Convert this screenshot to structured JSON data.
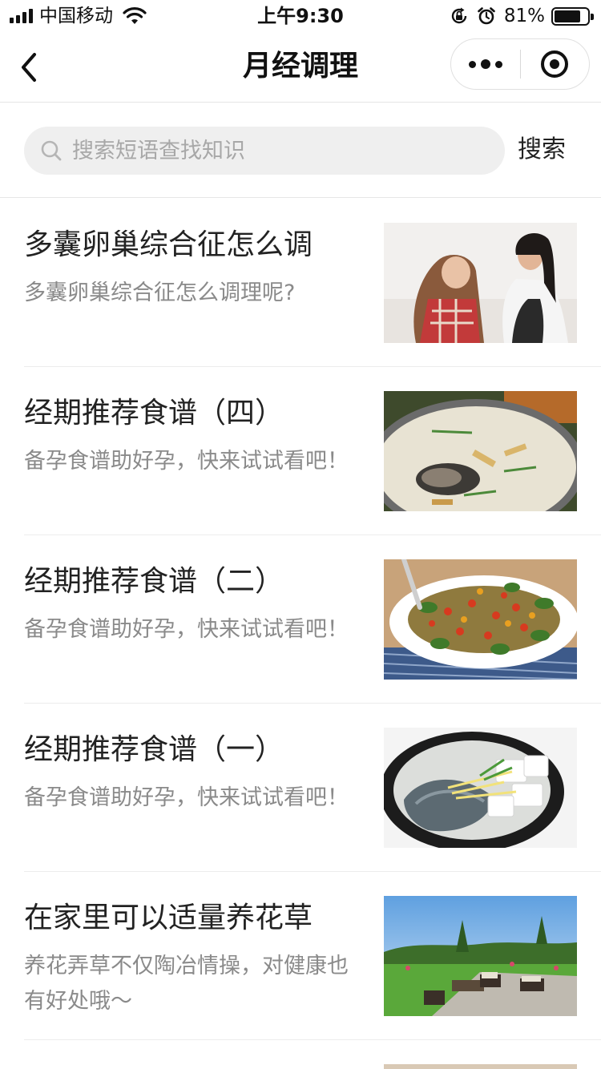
{
  "status_bar": {
    "carrier": "中国移动",
    "time": "上午9:30",
    "battery_percent": "81%",
    "battery_level": 0.81
  },
  "nav": {
    "title": "月经调理"
  },
  "search": {
    "placeholder": "搜索短语查找知识",
    "button_label": "搜索"
  },
  "articles": [
    {
      "title": "多囊卵巢综合征怎么调",
      "desc": "多囊卵巢综合征怎么调理呢?",
      "image": "two-women-talking-photo"
    },
    {
      "title": "经期推荐食谱（四）",
      "desc": "备孕食谱助好孕，快来试试看吧！",
      "image": "fish-soup-photo"
    },
    {
      "title": "经期推荐食谱（二）",
      "desc": "备孕食谱助好孕，快来试试看吧！",
      "image": "vegetable-dish-photo"
    },
    {
      "title": "经期推荐食谱（一）",
      "desc": "备孕食谱助好孕，快来试试看吧！",
      "image": "fish-tofu-pot-photo"
    },
    {
      "title": "在家里可以适量养花草",
      "desc": "养花弄草不仅陶冶情操，对健康也有好处哦～",
      "image": "garden-patio-photo"
    }
  ]
}
